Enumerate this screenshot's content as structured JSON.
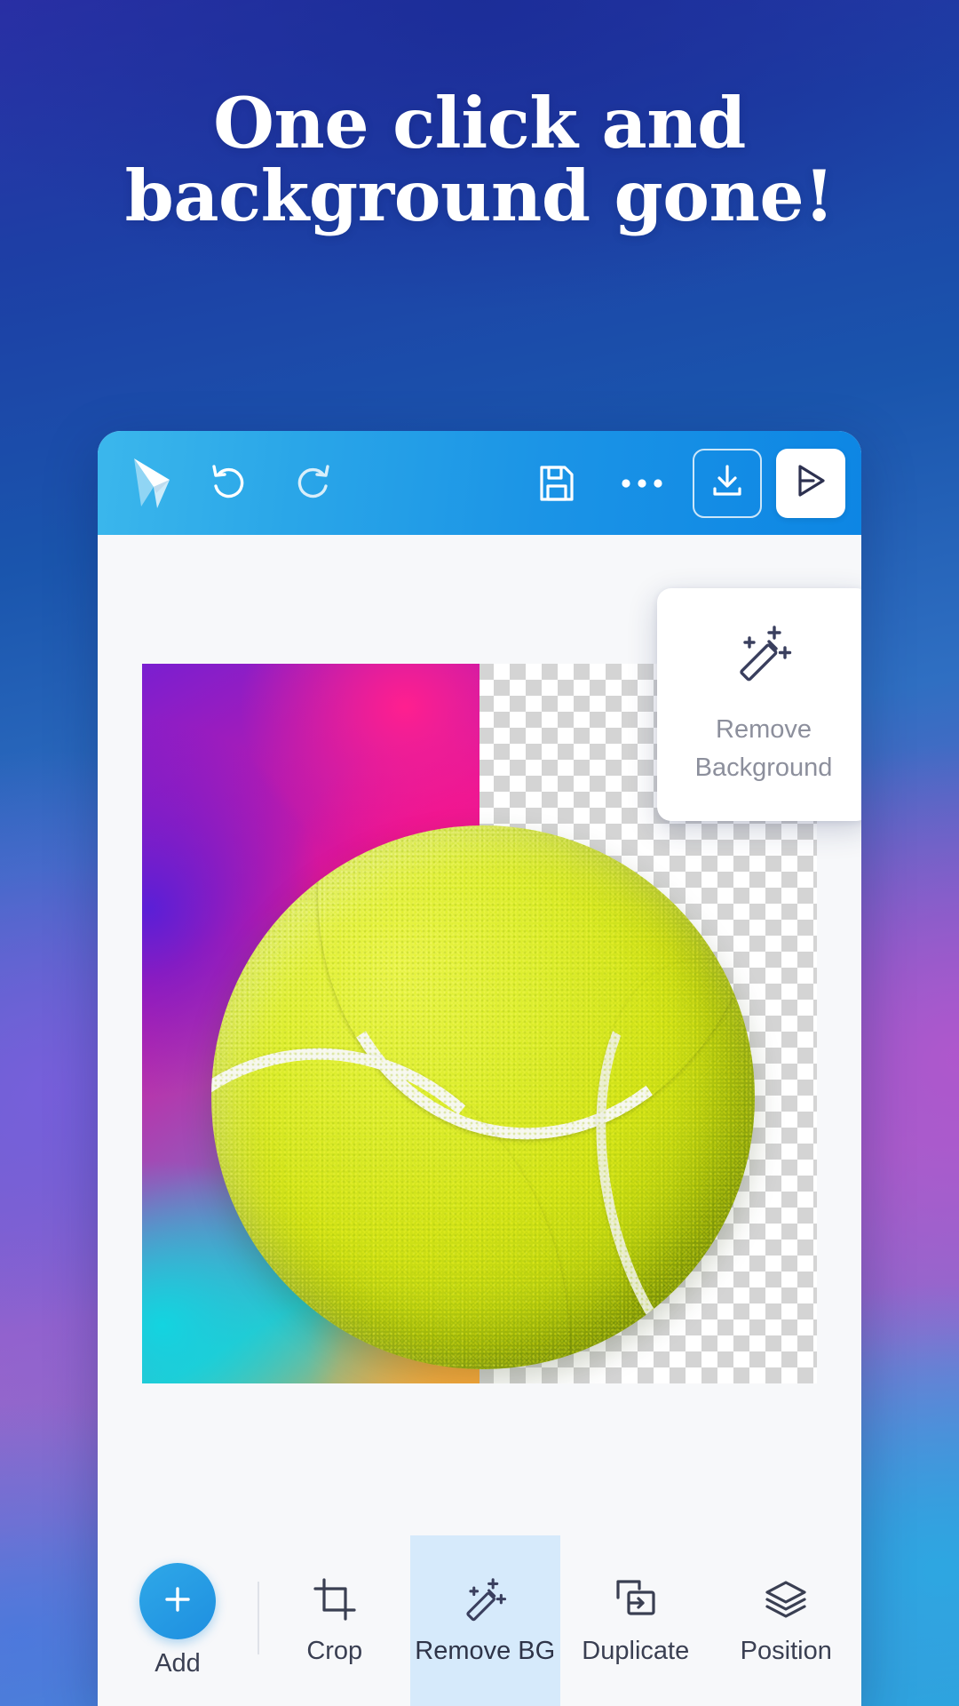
{
  "headline": {
    "line1": "One click and",
    "line2": "background gone!"
  },
  "colors": {
    "accent_blue": "#1b94e6",
    "add_button": "#1e8fe0",
    "active_tool_bg": "#d6eafb",
    "icon_dark": "#3a3f52",
    "tooltip_text": "#8c8f9c",
    "bg_top": "#2b2fa6",
    "bg_bottom": "#2f9fdb"
  },
  "app": {
    "toolbar": {
      "logo": "app-logo-icon",
      "undo": "undo-icon",
      "redo": "redo-icon",
      "save": "save-floppy-icon",
      "more": "more-options-icon",
      "download": "download-icon",
      "send": "send-icon"
    },
    "tooltip": {
      "icon": "magic-wand-icon",
      "line1": "Remove",
      "line2": "Background"
    },
    "canvas": {
      "artboard": "image-artboard",
      "subject": "tennis-ball-image",
      "transparency": "checkerboard-transparency"
    },
    "bottom_toolbar": {
      "add_label": "Add",
      "add_icon": "plus-icon",
      "tools": [
        {
          "label": "Crop",
          "icon": "crop-icon",
          "active": false
        },
        {
          "label": "Remove BG",
          "icon": "magic-wand-icon",
          "active": true
        },
        {
          "label": "Duplicate",
          "icon": "duplicate-icon",
          "active": false
        },
        {
          "label": "Position",
          "icon": "layers-icon",
          "active": false
        }
      ]
    }
  }
}
